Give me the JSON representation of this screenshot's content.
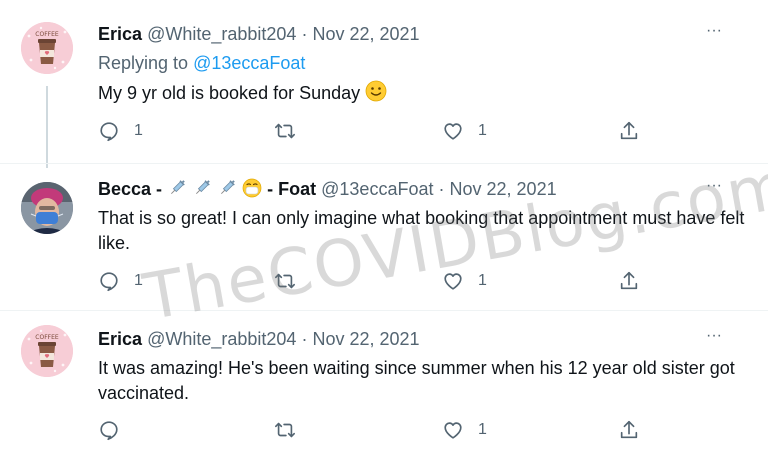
{
  "colors": {
    "link": "#1d9bf0",
    "muted": "#536471",
    "text": "#0f1419"
  },
  "tweets": [
    {
      "name": "Erica",
      "handle": "@White_rabbit204",
      "sep": "·",
      "date": "Nov 22, 2021",
      "replying_prefix": "Replying to",
      "replying_handle": "@13eccaFoat",
      "text": "My 9 yr old is booked for Sunday",
      "emoji": "slightly-smiling-face",
      "reply_count": "1",
      "like_count": "1"
    },
    {
      "name_start": "Becca -",
      "name_end": "- Foat",
      "name_emojis": [
        "syringe-icon",
        "syringe-icon",
        "syringe-icon",
        "face-with-mask-icon"
      ],
      "handle": "@13eccaFoat",
      "sep": "·",
      "date": "Nov 22, 2021",
      "text": "That is so great! I can only imagine what booking that appointment must have felt like.",
      "reply_count": "1",
      "like_count": "1"
    },
    {
      "name": "Erica",
      "handle": "@White_rabbit204",
      "sep": "·",
      "date": "Nov 22, 2021",
      "text": "It was amazing! He's been waiting since summer when his 12 year old sister got vaccinated.",
      "reply_count": "",
      "like_count": "1"
    }
  ],
  "more_label": "···",
  "avatar_text": "COFFEE",
  "watermark": "TheCOVIDBlog.com"
}
